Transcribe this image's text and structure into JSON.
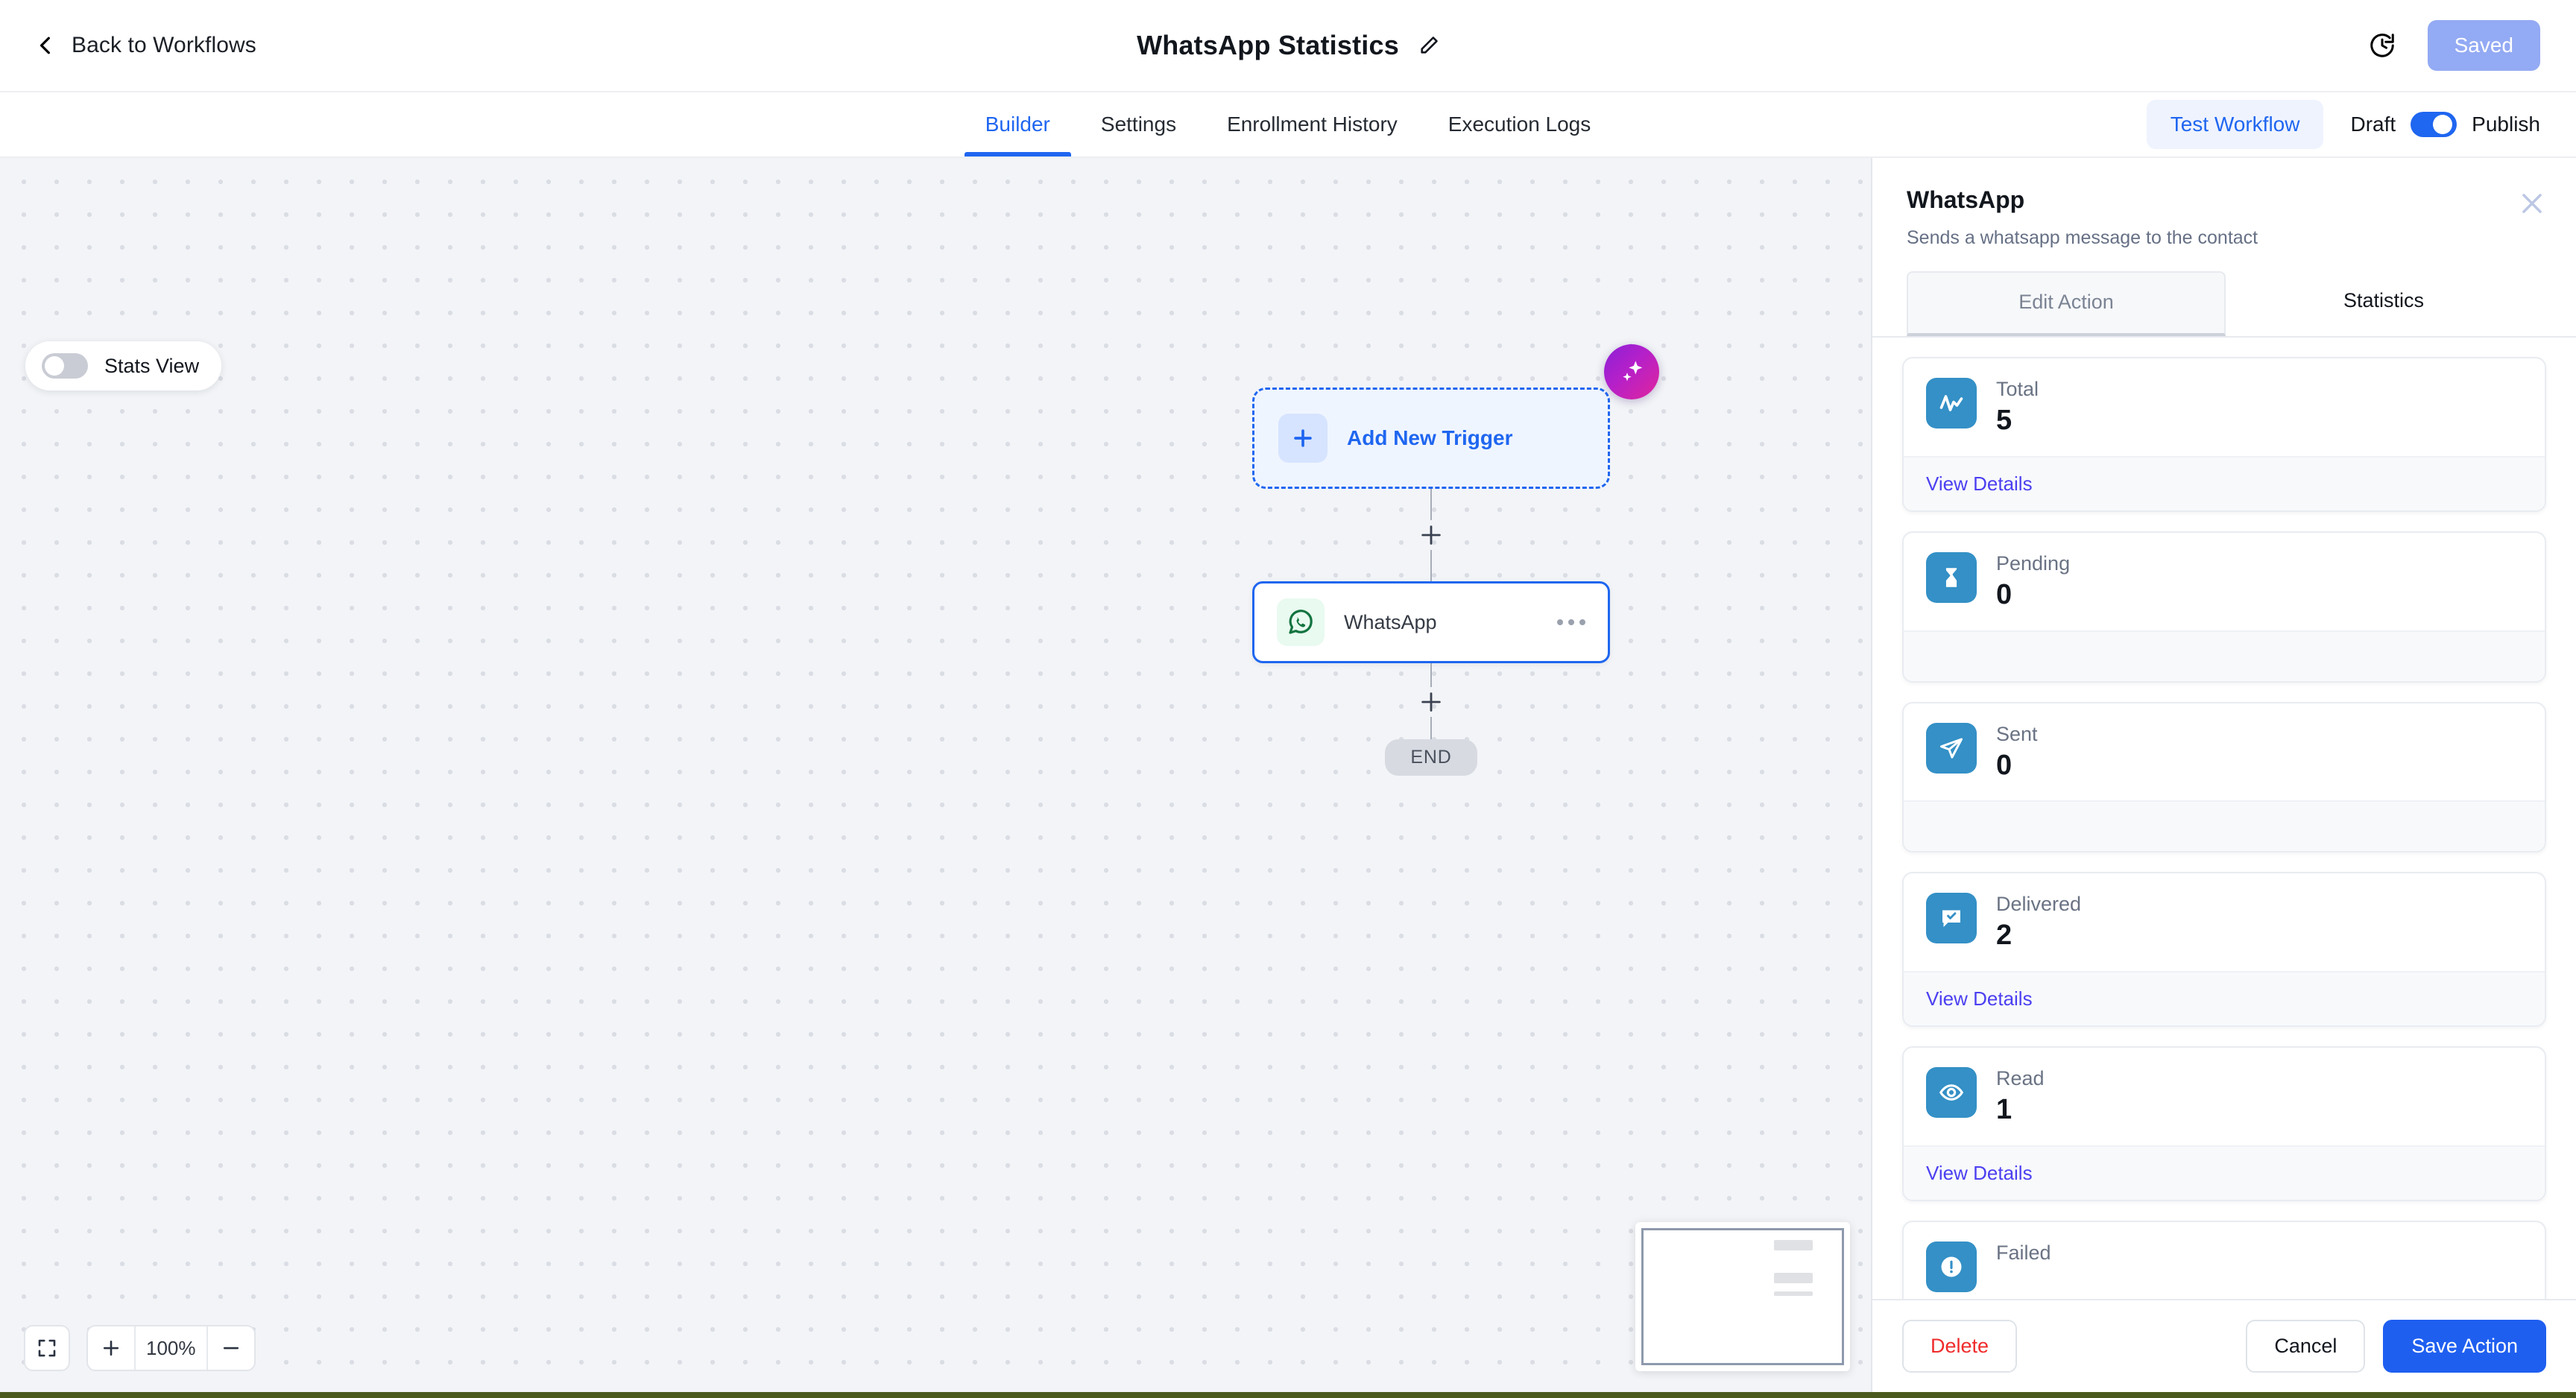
{
  "topbar": {
    "back_label": "Back to Workflows",
    "title": "WhatsApp Statistics",
    "edit_icon": "pencil-icon",
    "history_icon": "history-clock-icon",
    "saved_label": "Saved",
    "saved_color": "#93aaf4"
  },
  "tabbar": {
    "tabs": [
      {
        "label": "Builder",
        "active": true
      },
      {
        "label": "Settings",
        "active": false
      },
      {
        "label": "Enrollment History",
        "active": false
      },
      {
        "label": "Execution Logs",
        "active": false
      }
    ],
    "test_workflow_label": "Test Workflow",
    "draft_label": "Draft",
    "publish_label": "Publish",
    "publish_on": true,
    "accent_color": "#1f66f0"
  },
  "canvas": {
    "stats_view_label": "Stats View",
    "stats_view_on": false,
    "ai_button_icon": "sparkle-ai-icon",
    "trigger_label": "Add New Trigger",
    "trigger_icon": "plus-icon",
    "action_label": "WhatsApp",
    "action_icon": "whatsapp-icon",
    "action_menu_icon": "ellipsis-icon",
    "end_label": "END",
    "zoom": {
      "fit_icon": "fit-screen-icon",
      "zoom_in_icon": "plus-icon",
      "zoom_out_icon": "minus-icon",
      "level": "100%"
    },
    "minimap_label": "minimap"
  },
  "panel": {
    "title": "WhatsApp",
    "subtitle": "Sends a whatsapp message to the contact",
    "close_icon": "close-icon",
    "tabs": [
      {
        "label": "Edit Action",
        "active": false
      },
      {
        "label": "Statistics",
        "active": true
      }
    ],
    "stats": [
      {
        "label": "Total",
        "value": "5",
        "icon": "activity-line-icon",
        "link": "View Details",
        "has_link": true
      },
      {
        "label": "Pending",
        "value": "0",
        "icon": "hourglass-icon",
        "link": "",
        "has_link": false
      },
      {
        "label": "Sent",
        "value": "0",
        "icon": "paper-plane-icon",
        "link": "",
        "has_link": false
      },
      {
        "label": "Delivered",
        "value": "2",
        "icon": "message-check-icon",
        "link": "View Details",
        "has_link": true
      },
      {
        "label": "Read",
        "value": "1",
        "icon": "eye-icon",
        "link": "View Details",
        "has_link": true
      },
      {
        "label": "Failed",
        "value": "",
        "icon": "alert-circle-icon",
        "link": "",
        "has_link": false
      }
    ],
    "stat_icon_color": "#3490c6",
    "link_color": "#4b3ff0",
    "footer": {
      "delete_label": "Delete",
      "cancel_label": "Cancel",
      "save_label": "Save Action",
      "delete_color": "#ef2b2b",
      "save_color": "#1f5ff0"
    }
  }
}
